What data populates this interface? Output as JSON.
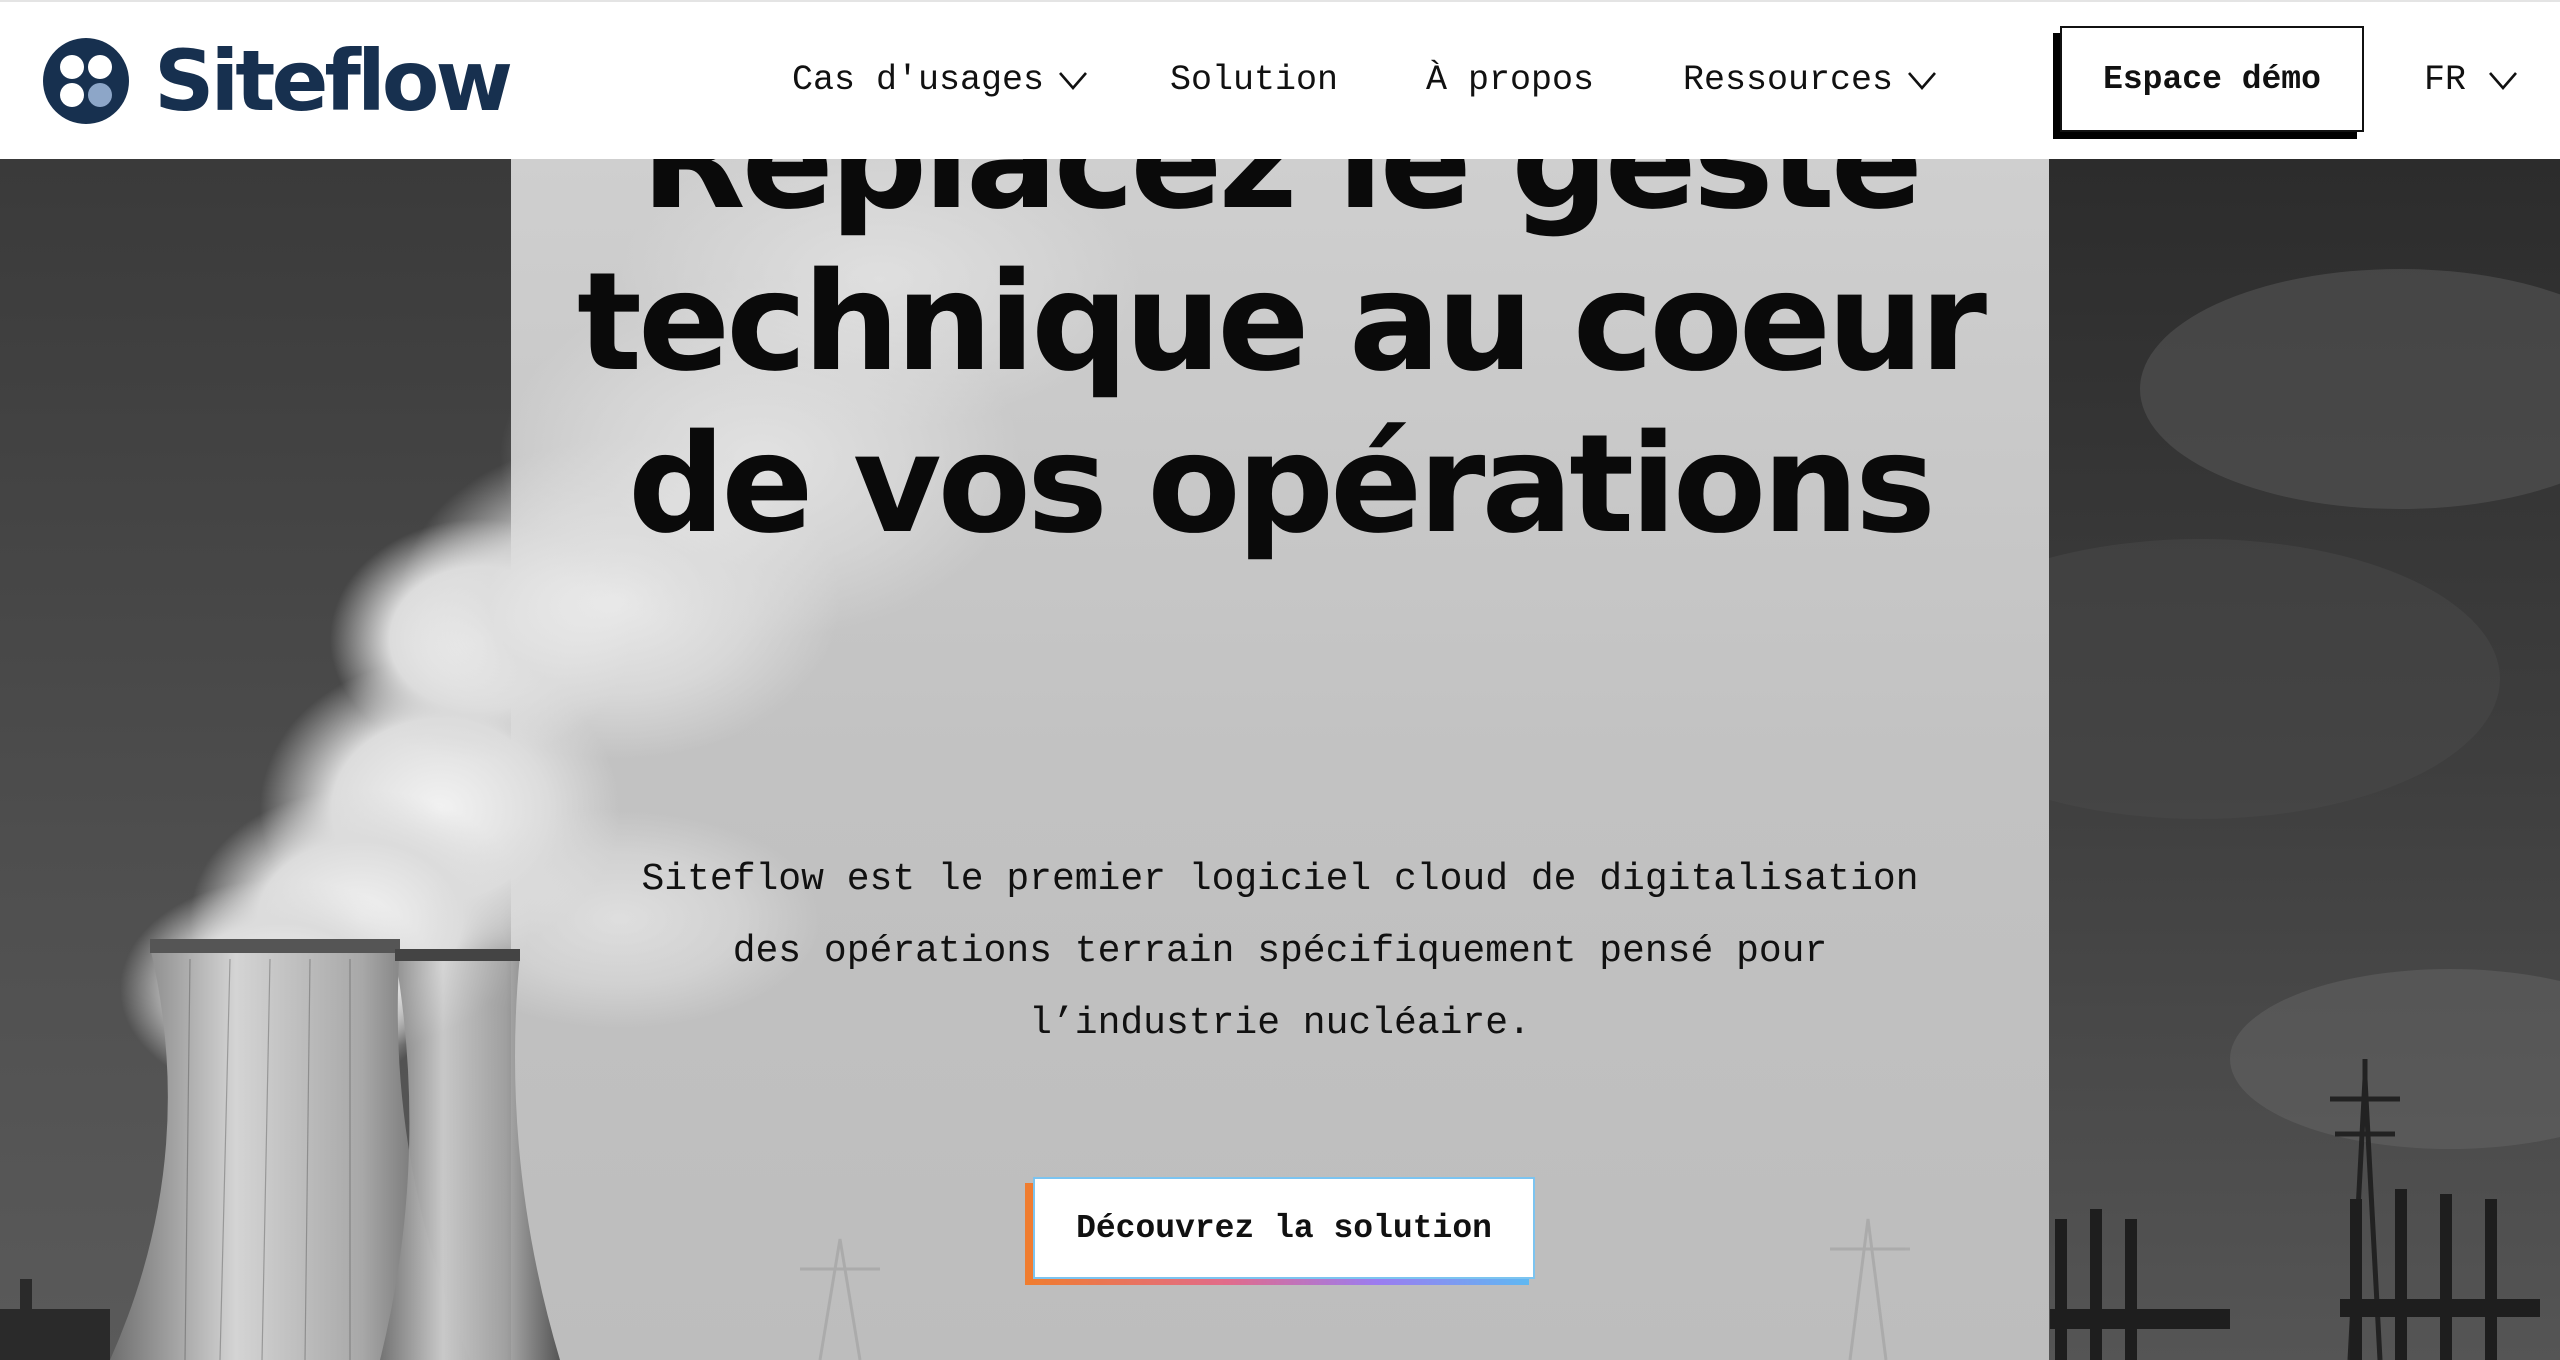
{
  "brand": {
    "name": "Siteflow",
    "color": "#17304f"
  },
  "nav": {
    "items": [
      {
        "label": "Cas d'usages",
        "has_dropdown": true,
        "icon": "chevron-down-icon"
      },
      {
        "label": "Solution",
        "has_dropdown": false
      },
      {
        "label": "À propos",
        "has_dropdown": false
      },
      {
        "label": "Ressources",
        "has_dropdown": true,
        "icon": "chevron-down-icon"
      }
    ],
    "demo_button": "Espace démo",
    "language": {
      "selected": "FR",
      "icon": "chevron-down-icon"
    }
  },
  "hero": {
    "title_lines": [
      "Replacez le geste",
      "technique au coeur",
      "de vos opérations"
    ],
    "description_lines": [
      "Siteflow est le premier logiciel cloud de digitalisation",
      "des opérations terrain spécifiquement pensé pour",
      "l’industrie nucléaire."
    ],
    "cta_label": "Découvrez la solution",
    "cta_gradient": [
      "#f07d2e",
      "#e16b8a",
      "#9b7cf0",
      "#5fb8f2"
    ],
    "background": "black-and-white photo of nuclear cooling towers with steam, power pylons and cranes"
  }
}
